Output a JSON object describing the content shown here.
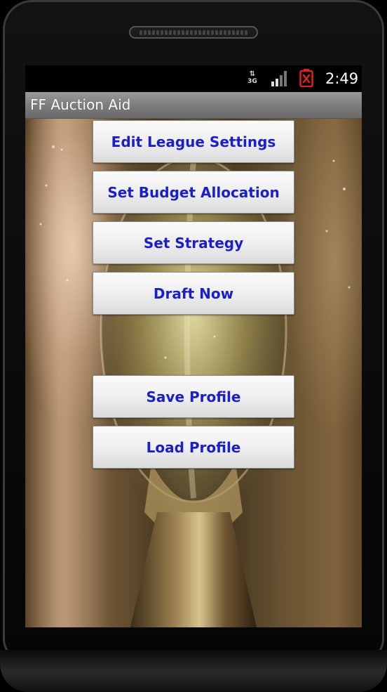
{
  "status_bar": {
    "network_type": "3G",
    "time": "2:49",
    "icons": [
      "data-arrows-icon",
      "signal-bars-icon",
      "battery-alert-icon"
    ]
  },
  "app": {
    "title": "FF Auction Aid"
  },
  "buttons": {
    "edit_league_settings": "Edit League Settings",
    "set_budget_allocation": "Set Budget Allocation",
    "set_strategy": "Set Strategy",
    "draft_now": "Draft Now",
    "save_profile": "Save Profile",
    "load_profile": "Load Profile"
  },
  "colors": {
    "button_text": "#1a1fc8",
    "title_bar": "#7b7b7b",
    "battery_alert": "#e02020"
  }
}
